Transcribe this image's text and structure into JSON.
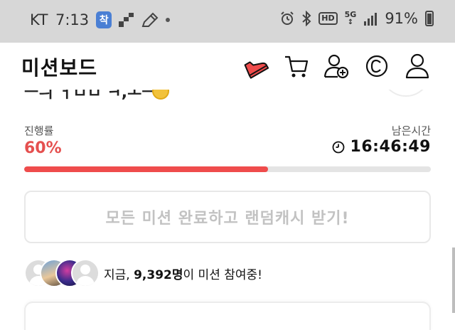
{
  "status_bar": {
    "carrier": "KT",
    "time": "7:13",
    "app_badge": "착",
    "battery": "91%"
  },
  "header": {
    "title": "미션보드",
    "icons": [
      "sneaker-icon",
      "cart-icon",
      "add-friend-icon",
      "cash-coin-icon",
      "profile-icon"
    ]
  },
  "progress": {
    "label": "진행률",
    "value_text": "60%",
    "fraction": 0.6,
    "remaining_label": "남은시간",
    "remaining_time": "16:46:49"
  },
  "cta": {
    "label": "모든 미션 완료하고 랜덤캐시 받기!"
  },
  "participants": {
    "prefix": "지금, ",
    "count": "9,392명",
    "suffix": "이 미션 참여중!"
  },
  "colors": {
    "accent": "#ef4c4c",
    "cta_text": "#c2c2c2",
    "track": "#e4e4e4"
  }
}
